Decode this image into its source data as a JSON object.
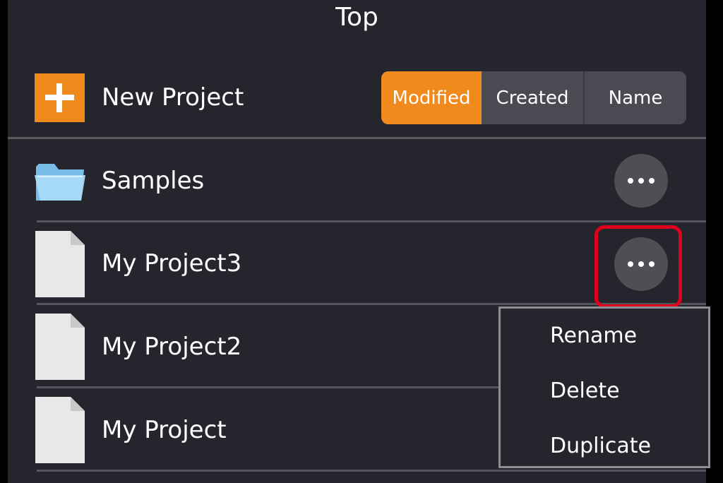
{
  "header": {
    "title": "Top"
  },
  "toolbar": {
    "new_project_label": "New Project",
    "sort_options": [
      "Modified",
      "Created",
      "Name"
    ],
    "active_sort": "Modified"
  },
  "list": {
    "items": [
      {
        "label": "Samples",
        "type": "folder"
      },
      {
        "label": "My Project3",
        "type": "document"
      },
      {
        "label": "My Project2",
        "type": "document"
      },
      {
        "label": "My Project",
        "type": "document"
      }
    ]
  },
  "context_menu": {
    "items": [
      "Rename",
      "Delete",
      "Duplicate"
    ]
  },
  "colors": {
    "accent": "#f08a1d",
    "background": "#25262d",
    "highlight": "#e0001b"
  }
}
